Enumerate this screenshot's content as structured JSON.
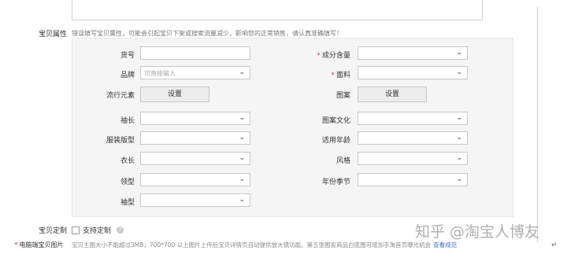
{
  "form": {
    "attr_section_label": "宝贝属性",
    "attr_hint": "错误填写宝贝属性，可能会引起宝贝下架或搜索流量减少，影响您的正常销售，请认真准确填写！",
    "left_fields": [
      {
        "label": "货号",
        "type": "text",
        "required": false,
        "value": "",
        "placeholder": ""
      },
      {
        "label": "品牌",
        "type": "select",
        "required": false,
        "value": "",
        "placeholder": "可直接输入"
      },
      {
        "label": "流行元素",
        "type": "button",
        "required": false,
        "button_label": "设置"
      },
      {
        "label": "袖长",
        "type": "select",
        "required": false,
        "value": ""
      },
      {
        "label": "服装版型",
        "type": "select",
        "required": false,
        "value": ""
      },
      {
        "label": "衣长",
        "type": "select",
        "required": false,
        "value": ""
      },
      {
        "label": "领型",
        "type": "select",
        "required": false,
        "value": ""
      },
      {
        "label": "袖型",
        "type": "select",
        "required": false,
        "value": ""
      }
    ],
    "right_fields": [
      {
        "label": "成分含量",
        "type": "select",
        "required": true,
        "value": ""
      },
      {
        "label": "面料",
        "type": "select",
        "required": true,
        "value": ""
      },
      {
        "label": "图案",
        "type": "button",
        "required": false,
        "button_label": "设置"
      },
      {
        "label": "图案文化",
        "type": "select",
        "required": false,
        "value": ""
      },
      {
        "label": "适用年龄",
        "type": "select",
        "required": false,
        "value": ""
      },
      {
        "label": "风格",
        "type": "select",
        "required": false,
        "value": ""
      },
      {
        "label": "年份季节",
        "type": "select",
        "required": false,
        "value": ""
      }
    ],
    "required_mark": "*",
    "select_chevron": "⌄",
    "custom_section_label": "宝贝定制",
    "custom_checkbox_label": "支持定制",
    "help_icon_glyph": "?",
    "pic_section_label": "电脑端宝贝图片",
    "pic_hint": "宝贝主图大小不能超过3MB；700*700 以上图片上传后宝贝详情页自动提供放大镜功能。第五张图发商品白底图可增加手淘首页曝光机会",
    "pic_link": "查看规范"
  },
  "watermark": "知乎 @淘宝人博友",
  "return_mark": "↵"
}
